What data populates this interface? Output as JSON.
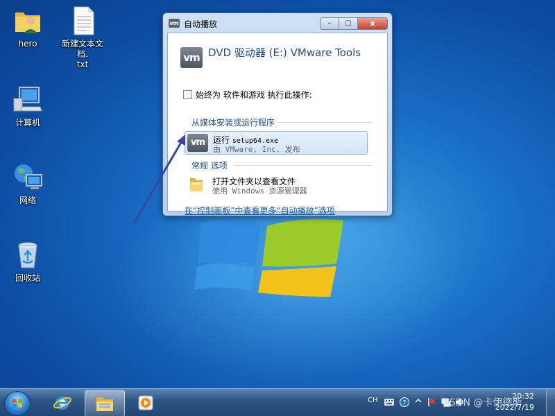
{
  "desktop": {
    "icons": [
      {
        "label": "hero",
        "icon": "user-folder-icon"
      },
      {
        "label": "新建文本文档.\ntxt",
        "icon": "text-file-icon"
      },
      {
        "label": "计算机",
        "icon": "computer-icon"
      },
      {
        "label": "网络",
        "icon": "network-icon"
      },
      {
        "label": "回收站",
        "icon": "recycle-bin-icon"
      }
    ]
  },
  "window": {
    "title": "自动播放",
    "icon_text": "vm",
    "drive_title": "DVD 驱动器 (E:) VMware Tools",
    "always_label": "始终为 软件和游戏 执行此操作:",
    "section_install": "从媒体安装或运行程序",
    "run_option": {
      "prefix": "运行 ",
      "command": "setup64.exe",
      "subtitle": "由 VMware, Inc. 发布"
    },
    "section_general": "常规 选项",
    "folder_option": {
      "title": "打开文件夹以查看文件",
      "subtitle": "使用 Windows 资源管理器"
    },
    "control_panel_link": "在“控制面板”中查看更多“自动播放”选项",
    "buttons": {
      "minimize": "–",
      "maximize": "□",
      "close": "x"
    }
  },
  "taskbar": {
    "language": "CH",
    "clock_time": "20:32",
    "clock_date": "2022/7/19",
    "watermark": "CSDN @卡伊德斯"
  },
  "colors": {
    "desktop_bg": "#1a6fc6",
    "link": "#1a5fb4",
    "heading_blue": "#1d4b91",
    "arrow": "#3b45a8"
  }
}
